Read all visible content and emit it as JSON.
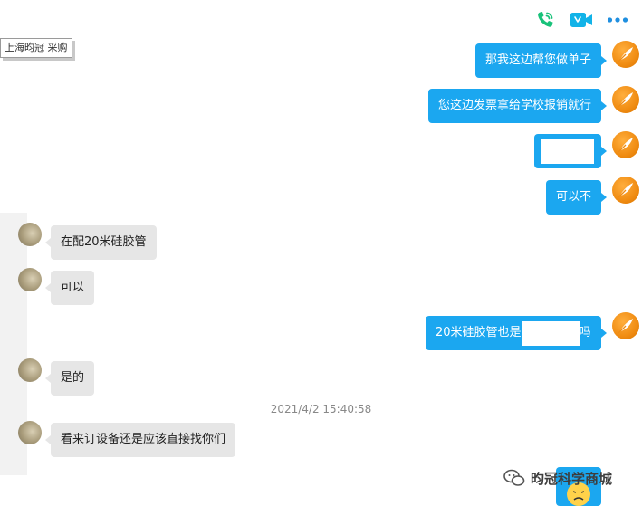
{
  "toolbar": {
    "voice_call_icon": "phone-icon",
    "video_call_icon": "video-camera-icon",
    "more_icon": "more-dots-icon",
    "accent_color": "#19c27a",
    "video_color": "#12b3e8",
    "dots_color": "#1f8fe0"
  },
  "tooltip": {
    "text": "上海昀冠 采购"
  },
  "messages": {
    "m1": "那我这边帮您做单子",
    "m2": "您这边发票拿给学校报销就行",
    "m4": "可以不",
    "m5": "在配20米硅胶管",
    "m6": "可以",
    "m7_prefix": "20米硅胶管也是",
    "m7_suffix": "吗",
    "m8": "是的",
    "m9": "看来订设备还是应该直接找你们"
  },
  "timestamp": "2021/4/2 15:40:58",
  "watermark": {
    "text": "昀冠科学商城",
    "icon": "wechat-official-account-icon"
  },
  "colors": {
    "bubble_out": "#1ba7f0",
    "bubble_in": "#e6e6e6",
    "avatar_right": "#f08c12"
  }
}
